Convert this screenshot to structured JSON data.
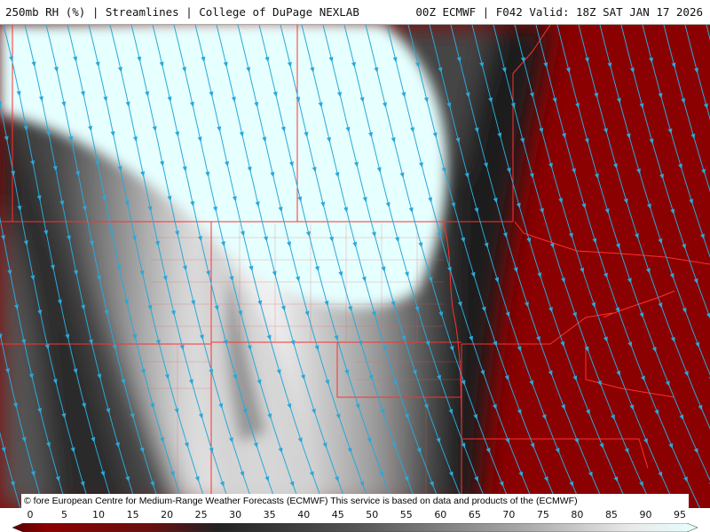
{
  "header": {
    "title_left": "250mb RH (%) | Streamlines | College of DuPage NEXLAB",
    "title_right": "00Z ECMWF | F042 Valid: 18Z SAT JAN 17 2026"
  },
  "credit": {
    "text": "© fore European Centre for Medium-Range Weather Forecasts (ECMWF)  This service is based on data and products of the (ECMWF)"
  },
  "legend": {
    "ticks": [
      "0",
      "5",
      "10",
      "15",
      "20",
      "25",
      "30",
      "35",
      "40",
      "45",
      "50",
      "55",
      "60",
      "65",
      "70",
      "75",
      "80",
      "85",
      "90",
      "95"
    ],
    "colors": {
      "low": "#8b0000",
      "mid_dark": "#3a3a3a",
      "mid_light": "#e0e0e0",
      "high": "#e6ffff"
    }
  },
  "map": {
    "streamline_color": "#2aa8d8",
    "border_color": "#ff3030"
  }
}
